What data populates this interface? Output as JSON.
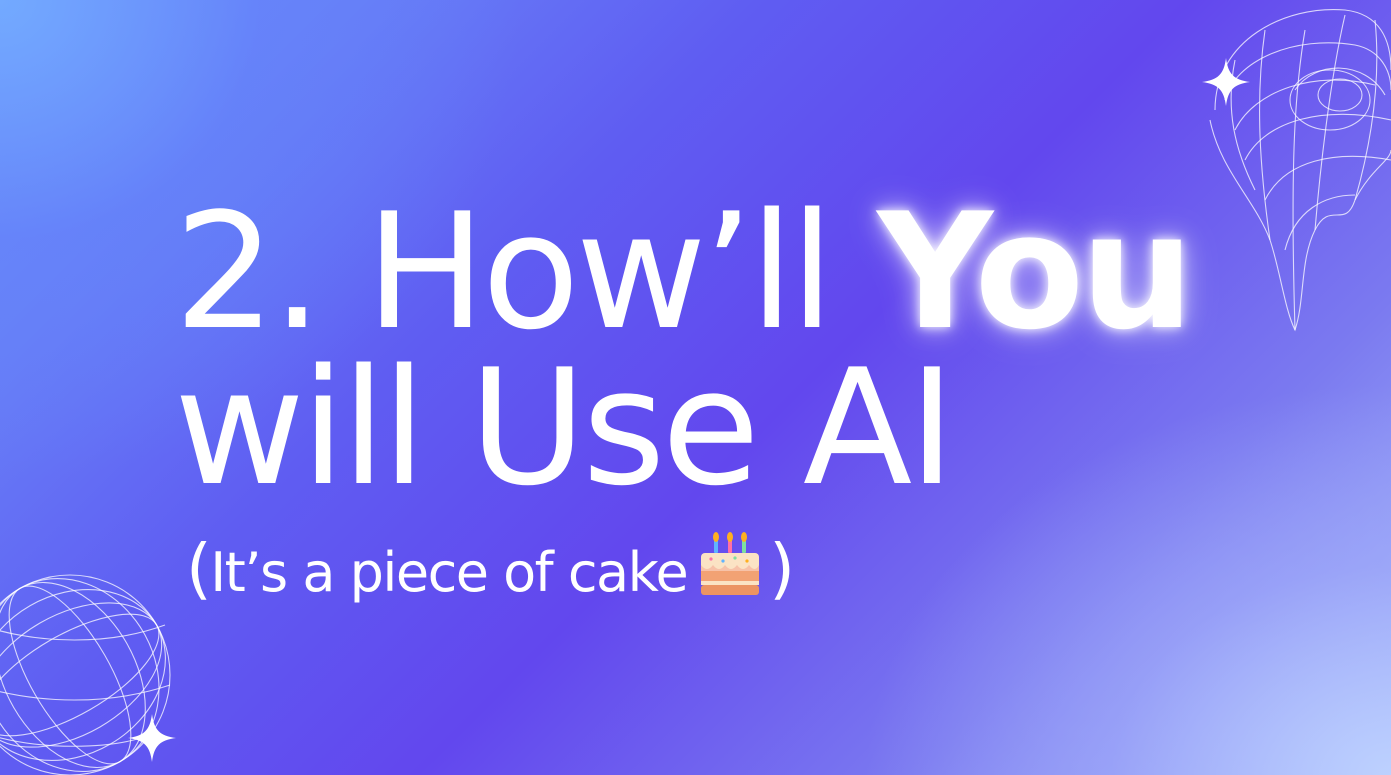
{
  "slide": {
    "title_part1": "2. How’ll ",
    "title_highlight": "You",
    "title_line2": "will Use AI",
    "subtitle_open": "(",
    "subtitle_text": "It’s a piece of cake",
    "subtitle_close": ")",
    "cake_icon": "birthday-cake-icon"
  },
  "colors": {
    "text": "#ffffff",
    "gradient_start": "#6f9cfb",
    "gradient_mid": "#6247ee",
    "gradient_end": "#a9bdfa"
  }
}
